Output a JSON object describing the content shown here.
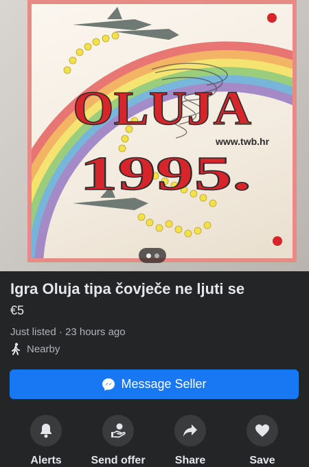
{
  "photo": {
    "board_text_title": "OLUJA",
    "board_text_year": "1995.",
    "board_url": "www.twb.hr"
  },
  "listing": {
    "title": "Igra Oluja tipa čovječe ne ljuti se",
    "price": "€5",
    "listed": "Just listed · 23 hours ago",
    "location": "Nearby"
  },
  "buttons": {
    "message_seller": "Message Seller"
  },
  "actions": [
    {
      "label": "Alerts",
      "icon": "bell-icon"
    },
    {
      "label": "Send offer",
      "icon": "offer-hand-icon"
    },
    {
      "label": "Share",
      "icon": "share-arrow-icon"
    },
    {
      "label": "Save",
      "icon": "heart-icon"
    }
  ],
  "colors": {
    "background": "#242526",
    "primary_button": "#1877f2",
    "secondary_text": "#b0b3b8",
    "title_red": "#d6262b"
  }
}
